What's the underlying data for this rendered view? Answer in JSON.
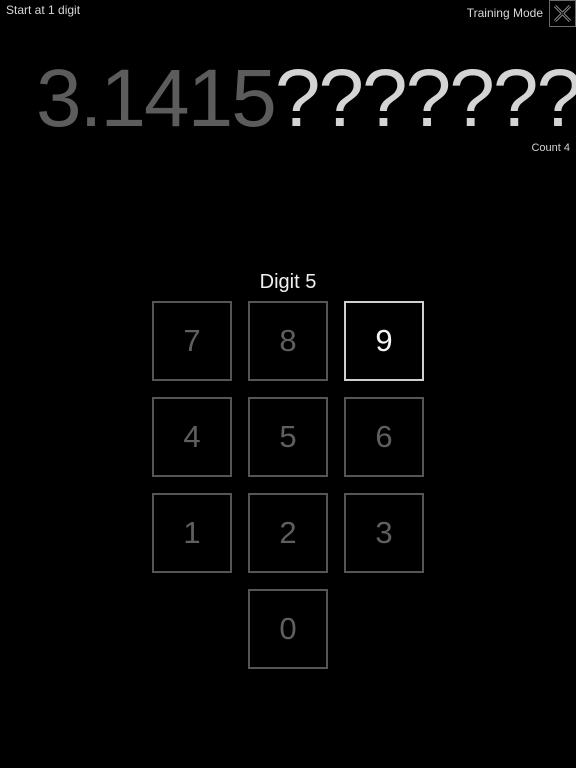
{
  "header": {
    "start_label": "Start at 1 digit",
    "mode_label": "Training Mode",
    "close_icon": "close-x-icon"
  },
  "display": {
    "known_digits": "3.1415",
    "unknown_digits": "???????",
    "count_label": "Count 4"
  },
  "prompt": {
    "digit_label": "Digit 5"
  },
  "keypad": {
    "keys": [
      {
        "label": "7",
        "active": false
      },
      {
        "label": "8",
        "active": false
      },
      {
        "label": "9",
        "active": true
      },
      {
        "label": "4",
        "active": false
      },
      {
        "label": "5",
        "active": false
      },
      {
        "label": "6",
        "active": false
      },
      {
        "label": "1",
        "active": false
      },
      {
        "label": "2",
        "active": false
      },
      {
        "label": "3",
        "active": false
      },
      {
        "label": "0",
        "active": false
      }
    ]
  },
  "colors": {
    "background": "#000000",
    "known_digit": "#5c5c5c",
    "unknown_digit": "#d4d4d4",
    "key_border": "#555555",
    "key_border_active": "#cfcfcf"
  }
}
